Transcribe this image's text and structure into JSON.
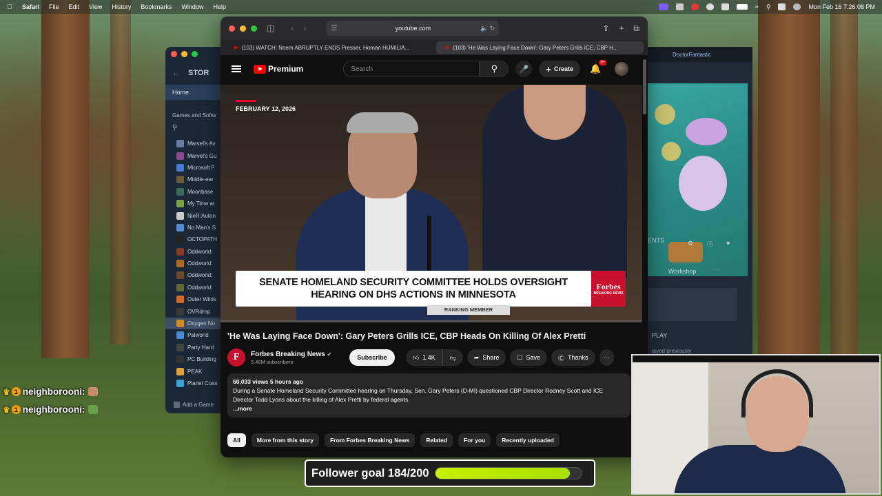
{
  "menubar": {
    "app": "Safari",
    "items": [
      "File",
      "Edit",
      "View",
      "History",
      "Bookmarks",
      "Window",
      "Help"
    ],
    "datetime": "Mon Feb 16  7:26:08 PM"
  },
  "steam": {
    "nav_title": "STOR",
    "home": "Home",
    "section": "Games and Softw",
    "games": [
      {
        "name": "Marvel's Av",
        "color": "#6a7ba0"
      },
      {
        "name": "Marvel's Gu",
        "color": "#8a4a8a"
      },
      {
        "name": "Microsoft F",
        "color": "#4a7ad0"
      },
      {
        "name": "Middle-ear",
        "color": "#6a5a3a"
      },
      {
        "name": "Moonbase",
        "color": "#3a6a5a"
      },
      {
        "name": "My Time at",
        "color": "#7aa04a"
      },
      {
        "name": "NieR:Auton",
        "color": "#ccc"
      },
      {
        "name": "No Man's S",
        "color": "#5a8ad0"
      },
      {
        "name": "OCTOPATH",
        "color": "#222"
      },
      {
        "name": "Oddworld:",
        "color": "#8a3a2a"
      },
      {
        "name": "Oddworld:",
        "color": "#aa6a2a"
      },
      {
        "name": "Oddworld:",
        "color": "#6a4a2a"
      },
      {
        "name": "Oddworld:",
        "color": "#5a6a3a"
      },
      {
        "name": "Outer Wilds",
        "color": "#d06a2a"
      },
      {
        "name": "OVRdrop",
        "color": "#3a3a3a"
      },
      {
        "name": "Oxygen No",
        "color": "#d08a2a"
      },
      {
        "name": "Palworld",
        "color": "#4a8ad0"
      },
      {
        "name": "Party Hard",
        "color": "#444"
      },
      {
        "name": "PC Building",
        "color": "#333"
      },
      {
        "name": "PEAK",
        "color": "#e0a040"
      },
      {
        "name": "Planet Coas",
        "color": "#3aa0d0"
      }
    ],
    "selected_index": 15,
    "add_game": "Add a Game",
    "right": {
      "user": "DoctorFantastic",
      "section_label": "ENTS",
      "workshop": "Workshop",
      "play": "PLAY",
      "played": "layed previously"
    }
  },
  "safari": {
    "url": "youtube.com",
    "tabs": [
      {
        "label": "(103) WATCH: Noem ABRUPTLY ENDS Presser, Homan HUMILIA...",
        "active": false
      },
      {
        "label": "(103) 'He Was Laying Face Down': Gary Peters Grills ICE, CBP H...",
        "active": true
      }
    ]
  },
  "youtube": {
    "logo": "Premium",
    "search_placeholder": "Search",
    "create": "Create",
    "notif_badge": "9+",
    "video": {
      "date": "FEBRUARY 12, 2026",
      "lower_third": "SENATE HOMELAND SECURITY COMMITTEE HOLDS OVERSIGHT HEARING ON DHS ACTIONS IN MINNESOTA",
      "brand": "Forbes",
      "brand_sub": "BREAKING NEWS",
      "nameplate": "RANKING MEMBER"
    },
    "title": "'He Was Laying Face Down': Gary Peters Grills ICE, CBP Heads On Killing Of Alex Pretti",
    "channel": {
      "initial": "F",
      "name": "Forbes Breaking News",
      "subs": "5.46M subscribers",
      "subscribe": "Subscribe"
    },
    "actions": {
      "likes": "1.4K",
      "share": "Share",
      "save": "Save",
      "thanks": "Thanks"
    },
    "description": {
      "meta": "60,033 views  5 hours ago",
      "text": "During a Senate Homeland Security Committee hearing on Thursday, Sen. Gary Peters (D-MI) questioned CBP Director Rodney Scott and ICE Director Todd Lyons about the killing of Alex Pretti by federal agents.",
      "more": "...more"
    },
    "chips": [
      "All",
      "More from this story",
      "From Forbes Breaking News",
      "Related",
      "For you",
      "Recently uploaded"
    ]
  },
  "chat": [
    {
      "user": "neighborooni:"
    },
    {
      "user": "neighborooni:"
    }
  ],
  "goal": {
    "label": "Follower goal 184/200",
    "progress": 0.92
  }
}
